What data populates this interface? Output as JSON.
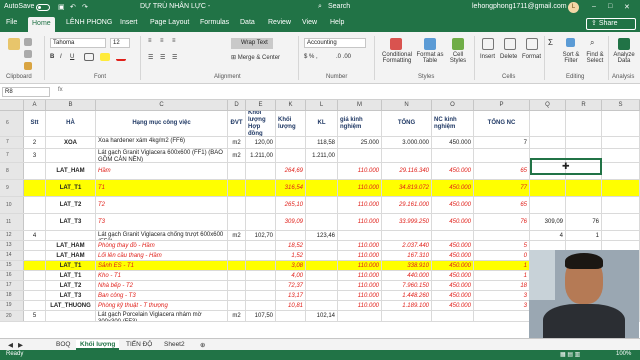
{
  "titlebar": {
    "autosave": "AutoSave",
    "file_title": "DỰ TRÙ NHÂN LỰC -",
    "search": "Search",
    "account_email": "lehongphong1711@gmail.com",
    "account_initial": "L"
  },
  "menu": {
    "tabs": [
      "File",
      "Home",
      "LÊNH PHONG",
      "Insert",
      "Page Layout",
      "Formulas",
      "Data",
      "Review",
      "View",
      "Help"
    ],
    "share": "Share"
  },
  "ribbon": {
    "font_name": "Tahoma",
    "font_size": "12",
    "wrap_text": "Wrap Text",
    "merge_center": "Merge & Center",
    "number_format": "Accounting",
    "groups": [
      "Clipboard",
      "Font",
      "Alignment",
      "Number",
      "Styles",
      "Cells",
      "Editing",
      "Analysis"
    ],
    "buttons": [
      "Conditional Formatting",
      "Format as Table",
      "Cell Styles",
      "Insert",
      "Delete",
      "Format",
      "Sort & Filter",
      "Find & Select",
      "Analyze Data"
    ]
  },
  "formula_bar": {
    "name_box": "R8",
    "fx": "fx"
  },
  "columns": [
    "A",
    "B",
    "C",
    "D",
    "E",
    "K",
    "L",
    "M",
    "N",
    "O",
    "P",
    "Q",
    "R",
    "S"
  ],
  "header_row": {
    "row_num": "6",
    "cells": [
      "Stt",
      "HÀ",
      "Hạng mục công việc",
      "ĐVT",
      "Khối lượng Hợp đồng",
      "Khối lượng",
      "KL",
      "giá kinh nghiệm",
      "TỔNG",
      "NC kinh nghiệm",
      "TỔNG NC",
      "",
      "",
      ""
    ]
  },
  "rows": [
    {
      "num": "7",
      "cells": [
        "2",
        "XOA",
        "Xoa hardener xám 4kg/m2  (FF6)",
        "m2",
        "120,00",
        "",
        "118,58",
        "25.000",
        "3.000.000",
        "450.000",
        "7",
        "",
        "",
        ""
      ]
    },
    {
      "num": "7",
      "cells": [
        "3",
        "",
        "Lát gạch Granit Viglacera 600x600 (FF1) (BAO GỒM CẢN NỀN)",
        "m2",
        "1.211,00",
        "",
        "1.211,00",
        "",
        "",
        "",
        "",
        "",
        "",
        ""
      ]
    },
    {
      "num": "8",
      "cells": [
        "",
        "LAT_HAM",
        "Hầm",
        "",
        "",
        "264,69",
        "",
        "110.000",
        "29.116.340",
        "450.000",
        "65",
        "",
        "",
        ""
      ]
    },
    {
      "num": "9",
      "cells": [
        "",
        "LAT_T1",
        "T1",
        "",
        "",
        "316,54",
        "",
        "110.000",
        "34.819.072",
        "450.000",
        "77",
        "",
        "",
        ""
      ]
    },
    {
      "num": "10",
      "cells": [
        "",
        "LAT_T2",
        "T2",
        "",
        "",
        "265,10",
        "",
        "110.000",
        "29.161.000",
        "450.000",
        "65",
        "",
        "",
        ""
      ]
    },
    {
      "num": "11",
      "cells": [
        "",
        "LAT_T3",
        "T3",
        "",
        "",
        "309,09",
        "",
        "110.000",
        "33.999.250",
        "450.000",
        "76",
        "309,09",
        "76",
        ""
      ]
    },
    {
      "num": "12",
      "cells": [
        "4",
        "",
        "Lát gạch Granit Viglacera chống trượt 600x600 (FF2)",
        "m2",
        "102,70",
        "",
        "123,46",
        "",
        "",
        "",
        "",
        "4",
        "1",
        ""
      ]
    },
    {
      "num": "13",
      "cells": [
        "",
        "LAT_HAM",
        "Phòng thay đồ - Hầm",
        "",
        "",
        "18,52",
        "",
        "110.000",
        "2.037.440",
        "450.000",
        "5",
        "",
        "",
        ""
      ]
    },
    {
      "num": "14",
      "cells": [
        "",
        "LAT_HAM",
        "Lối lên cầu thang - Hầm",
        "",
        "",
        "1,52",
        "",
        "110.000",
        "167.310",
        "450.000",
        "0",
        "",
        "",
        ""
      ]
    },
    {
      "num": "15",
      "cells": [
        "",
        "LAT_T1",
        "Sảnh ES - T1",
        "",
        "",
        "3,08",
        "",
        "110.000",
        "338.910",
        "450.000",
        "1",
        "",
        "",
        ""
      ]
    },
    {
      "num": "16",
      "cells": [
        "",
        "LAT_T1",
        "Kho - T1",
        "",
        "",
        "4,00",
        "",
        "110.000",
        "440.000",
        "450.000",
        "1",
        "",
        "",
        ""
      ]
    },
    {
      "num": "17",
      "cells": [
        "",
        "LAT_T2",
        "Nhà bếp - T2",
        "",
        "",
        "72,37",
        "",
        "110.000",
        "7.960.150",
        "450.000",
        "18",
        "",
        "",
        ""
      ]
    },
    {
      "num": "18",
      "cells": [
        "",
        "LAT_T3",
        "Ban công - T3",
        "",
        "",
        "13,17",
        "",
        "110.000",
        "1.448.260",
        "450.000",
        "3",
        "",
        "",
        ""
      ]
    },
    {
      "num": "19",
      "cells": [
        "",
        "LAT_THUONG",
        "Phòng kỹ thuật - T thượng",
        "",
        "",
        "10,81",
        "",
        "110.000",
        "1.189.100",
        "450.000",
        "3",
        "",
        "",
        ""
      ]
    },
    {
      "num": "20",
      "cells": [
        "5",
        "",
        "Lát gạch Porcelain Viglacera nhám mờ 300x300 (FF3)",
        "m2",
        "107,50",
        "",
        "102,14",
        "",
        "",
        "",
        "",
        "",
        "",
        ""
      ]
    }
  ],
  "sheet_tabs": [
    "BOQ",
    "Khối lượng",
    "TIẾN ĐỘ",
    "Sheet2"
  ],
  "active_sheet": "Khối lượng",
  "status": {
    "ready": "Ready",
    "zoom": "100%"
  },
  "colors": {
    "excel_green": "#217346",
    "highlight_yellow": "#ffff00",
    "italic_red": "#e0201a",
    "header_navy": "#1f3864"
  }
}
